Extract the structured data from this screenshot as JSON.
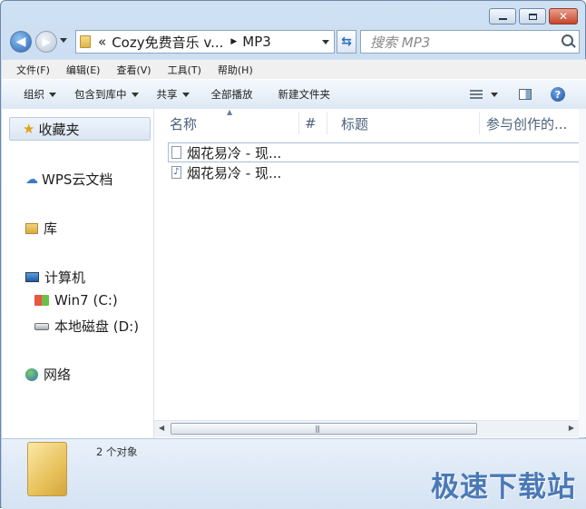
{
  "address": {
    "prefix": "«",
    "segments": [
      "Cozy免费音乐 v...",
      "MP3"
    ]
  },
  "search": {
    "placeholder": "搜索 MP3"
  },
  "menu": [
    "文件(F)",
    "编辑(E)",
    "查看(V)",
    "工具(T)",
    "帮助(H)"
  ],
  "toolbar": {
    "organize": "组织",
    "include": "包含到库中",
    "share": "共享",
    "play_all": "全部播放",
    "new_folder": "新建文件夹"
  },
  "nav": {
    "favorites": "收藏夹",
    "wps": "WPS云文档",
    "library": "库",
    "computer": "计算机",
    "drive_c": "Win7 (C:)",
    "drive_d": "本地磁盘 (D:)",
    "network": "网络"
  },
  "columns": [
    "名称",
    "#",
    "标题",
    "参与创作的..."
  ],
  "files": [
    {
      "name": "烟花易冷 - 现...",
      "icon": "text-file-icon"
    },
    {
      "name": "烟花易冷 - 现...",
      "icon": "music-file-icon"
    }
  ],
  "status": {
    "count": "2 个对象"
  },
  "watermark": "极速下载站",
  "colors": {
    "accent": "#2a63b6",
    "watermark": "#4b79b5"
  }
}
